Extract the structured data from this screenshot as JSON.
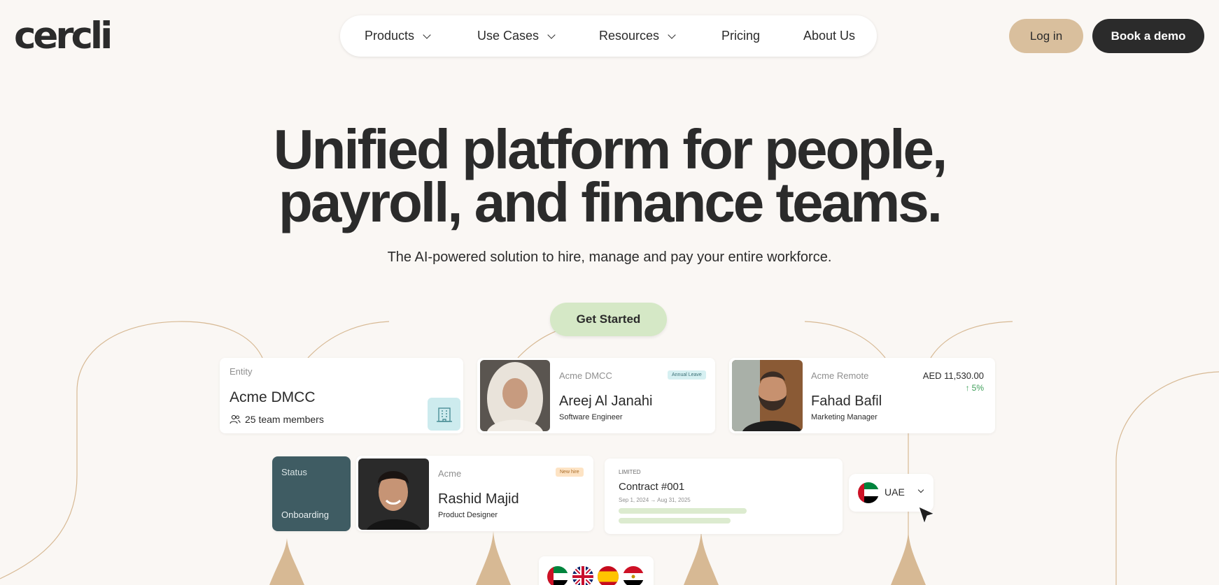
{
  "brand": {
    "logo_text": "cercli"
  },
  "nav": {
    "items": [
      {
        "label": "Products",
        "has_dropdown": true
      },
      {
        "label": "Use Cases",
        "has_dropdown": true
      },
      {
        "label": "Resources",
        "has_dropdown": true
      },
      {
        "label": "Pricing",
        "has_dropdown": false
      },
      {
        "label": "About Us",
        "has_dropdown": false
      }
    ],
    "login_label": "Log in",
    "demo_label": "Book a demo"
  },
  "hero": {
    "title_line1": "Unified platform for people,",
    "title_line2": "payroll, and finance teams.",
    "subtitle": "The AI-powered solution to hire, manage and pay your entire workforce.",
    "cta_label": "Get Started"
  },
  "cards": {
    "entity": {
      "label": "Entity",
      "name": "Acme DMCC",
      "members": "25 team members",
      "icon": "building-icon"
    },
    "employee1": {
      "company": "Acme DMCC",
      "badge": "Annual Leave",
      "name": "Areej Al Janahi",
      "role": "Software Engineer"
    },
    "employee2": {
      "company": "Acme Remote",
      "name": "Fahad Bafil",
      "role": "Marketing Manager",
      "salary": "AED 11,530.00",
      "change": "5%"
    },
    "status": {
      "label": "Status",
      "value": "Onboarding"
    },
    "employee3": {
      "company": "Acme",
      "badge": "New hire",
      "name": "Rashid Majid",
      "role": "Product Designer"
    },
    "contract": {
      "tag": "LIMITED",
      "title": "Contract #001",
      "dates": "Sep 1, 2024 → Aug 31, 2025"
    },
    "country": {
      "value": "UAE"
    }
  },
  "colors": {
    "background": "#faf7f4",
    "dark": "#2b2b2b",
    "login_bg": "#d9bf9d",
    "cta_bg": "#d5e8c6",
    "status_bg": "#3f5c63",
    "positive": "#3f9f5a",
    "annual_badge_bg": "#d6f0f2",
    "newhire_badge_bg": "#fde3c4",
    "curve": "#d7b994"
  },
  "icons": [
    "chevron-down-icon",
    "building-icon",
    "team-icon",
    "arrow-up-icon",
    "cursor-icon",
    "flag-uae-icon",
    "flag-uk-icon",
    "flag-spain-icon",
    "flag-egypt-icon"
  ]
}
